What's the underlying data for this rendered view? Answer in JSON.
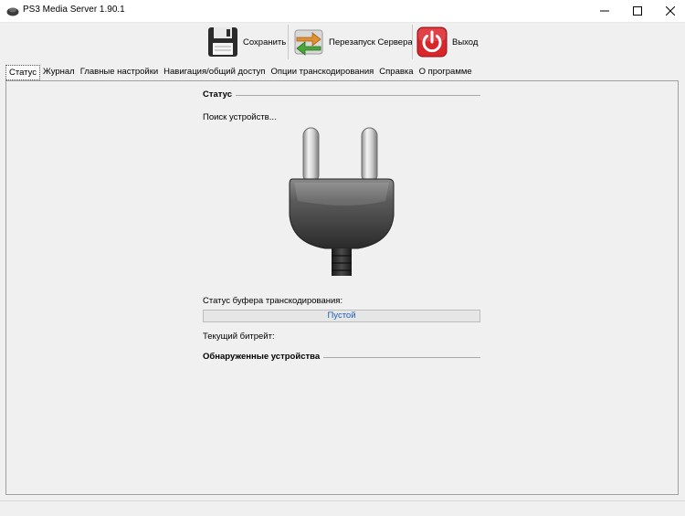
{
  "window": {
    "title": "PS3 Media Server 1.90.1"
  },
  "toolbar": {
    "save_label": "Сохранить",
    "restart_label": "Перезапуск Сервера",
    "exit_label": "Выход"
  },
  "tabs": [
    {
      "label": "Статус",
      "active": true
    },
    {
      "label": "Журнал",
      "active": false
    },
    {
      "label": "Главные настройки",
      "active": false
    },
    {
      "label": "Навигация/общий доступ",
      "active": false
    },
    {
      "label": "Опции транскодирования",
      "active": false
    },
    {
      "label": "Справка",
      "active": false
    },
    {
      "label": "О программе",
      "active": false
    }
  ],
  "status": {
    "section_title": "Статус",
    "searching_text": "Поиск устройств...",
    "buffer_label": "Статус буфера транскодирования:",
    "buffer_value_text": "Пустой",
    "buffer_fill": 0,
    "bitrate_label": "Текущий битрейт:",
    "devices_title": "Обнаруженные устройства"
  },
  "icons": {
    "save": "floppy-disk-icon",
    "restart": "restart-arrows-icon",
    "exit": "power-icon",
    "status_image": "power-plug-icon"
  },
  "colors": {
    "accent": "#1a5fb4",
    "exit_red": "#d8262b",
    "restart_green": "#4aa63a",
    "restart_orange": "#e2902e"
  }
}
